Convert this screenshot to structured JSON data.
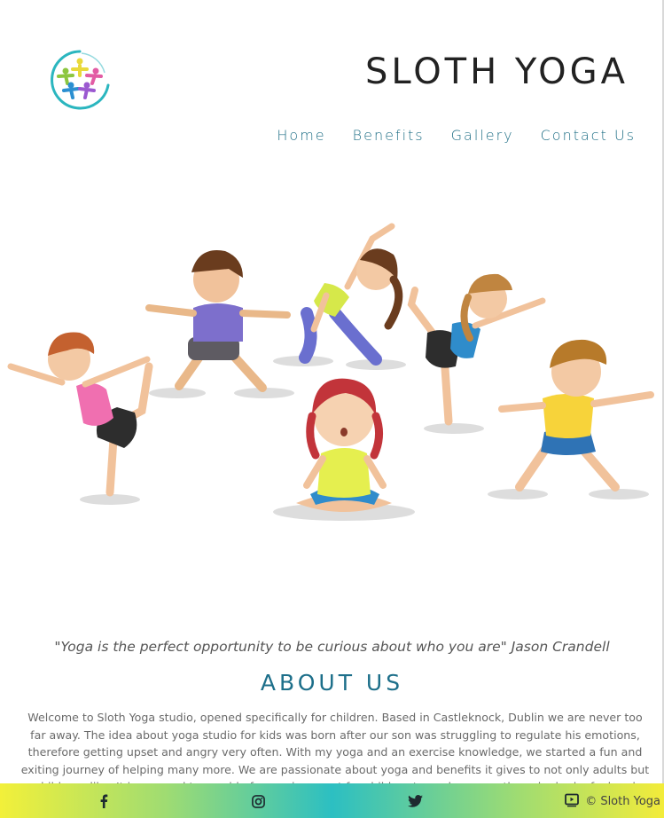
{
  "header": {
    "site_title": "SLOTH YOGA",
    "logo_icon": "yoga-people-logo-icon"
  },
  "nav": {
    "items": [
      {
        "label": "Home"
      },
      {
        "label": "Benefits"
      },
      {
        "label": "Gallery"
      },
      {
        "label": "Contact Us"
      }
    ]
  },
  "hero": {
    "image_icon": "kids-yoga-illustration"
  },
  "quote": "\"Yoga is the perfect opportunity to be curious about who you are\" Jason Crandell",
  "about": {
    "title": "ABOUT US",
    "text": "Welcome to Sloth Yoga studio, opened specifically for children. Based in Castleknock, Dublin we are never too far away. The idea about yoga studio for kids was born after our son was struggling to regulate his emotions, therefore getting upset and angry very often. With my yoga and an exercise knowledge, we started a fun and exiting journey of helping many more. We are passionate about yoga and benefits it gives to not only adults but children alike. It is our goal to provide fun environment for children to explore, see, the calm body, feel and"
  },
  "footer": {
    "social": [
      {
        "icon": "facebook-icon",
        "glyph": "f"
      },
      {
        "icon": "instagram-icon",
        "glyph": ""
      },
      {
        "icon": "twitter-icon",
        "glyph": ""
      },
      {
        "icon": "youtube-icon",
        "glyph": ""
      }
    ],
    "copyright": "© Sloth Yoga"
  },
  "colors": {
    "nav": "#1f6f86",
    "about_title": "#1d6f8a",
    "footer_gradient": [
      "#f2f03a",
      "#2cbfc2",
      "#f3ec3a"
    ]
  }
}
